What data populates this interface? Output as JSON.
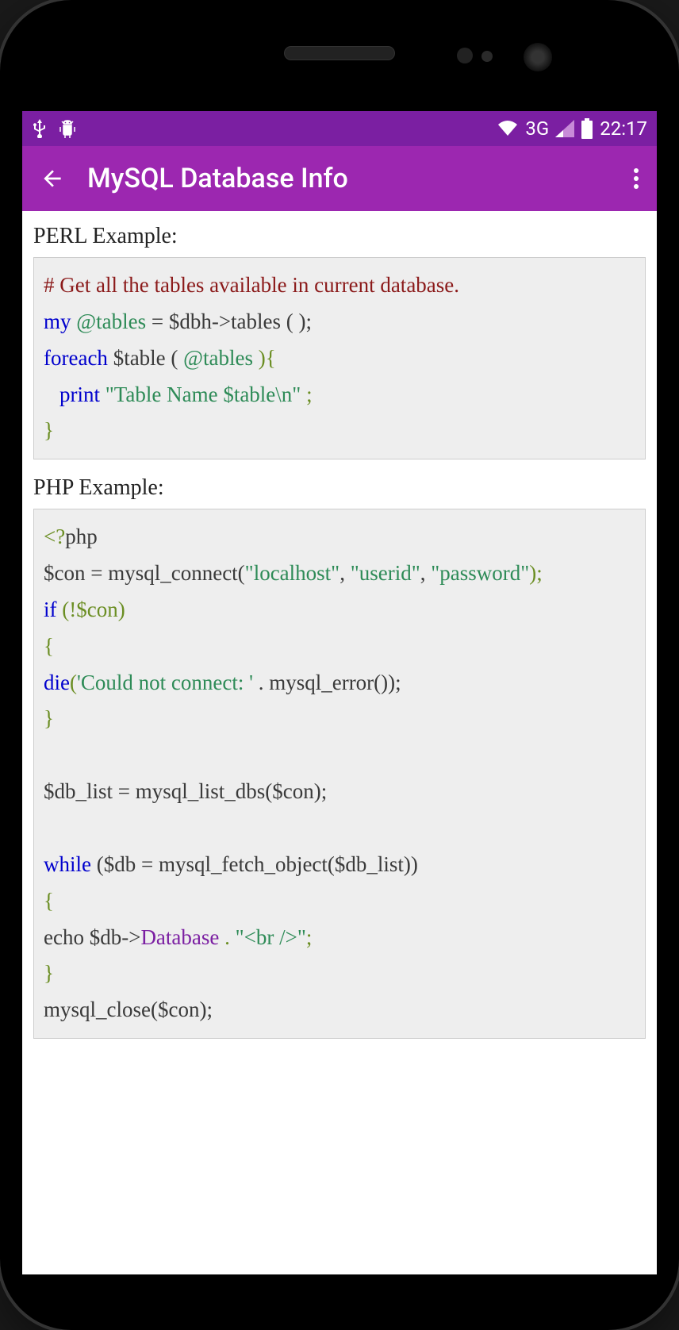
{
  "status": {
    "time": "22:17",
    "signal_label": "3G"
  },
  "appbar": {
    "title": "MySQL Database Info"
  },
  "sections": {
    "perl_title": "PERL Example:",
    "php_title": "PHP Example:"
  },
  "perl": {
    "comment": "# Get all the tables available in current database.",
    "my": "my",
    "tables_var": "@tables",
    "eq": " = $dbh->tables ( );",
    "foreach": "foreach",
    "table_var": " $table (",
    "tables_var2": "@tables",
    "foreach_close": " ){",
    "print": "print",
    "print_str": " \"Table Name $table\\n\"",
    "semicolon": ";",
    "close_brace": "}"
  },
  "php": {
    "open_tag": "<?",
    "php_word": "php",
    "con_assign": "$con = mysql_connect(",
    "localhost": "\"localhost\"",
    "comma1": ", ",
    "userid": "\"userid\"",
    "comma2": ", ",
    "password": "\"password\"",
    "close_paren": ");",
    "if": "if",
    "if_cond": " (!$con)",
    "open_brace": "{",
    "die": "die",
    "die_open": "(",
    "die_str": "'Could not connect: '",
    "die_concat": " . mysql_error());",
    "close_brace1": "}",
    "db_list": "$db_list = mysql_list_dbs($con);",
    "while": "while",
    "while_cond": " ($db = mysql_fetch_object($db_list))",
    "open_brace2": "{",
    "echo": " echo $db->",
    "database": "Database",
    "echo_concat": " . ",
    "br_str": "\"<br />\"",
    "echo_semi": ";",
    "close_brace2": "}",
    "mysql_close": "mysql_close($con);"
  }
}
